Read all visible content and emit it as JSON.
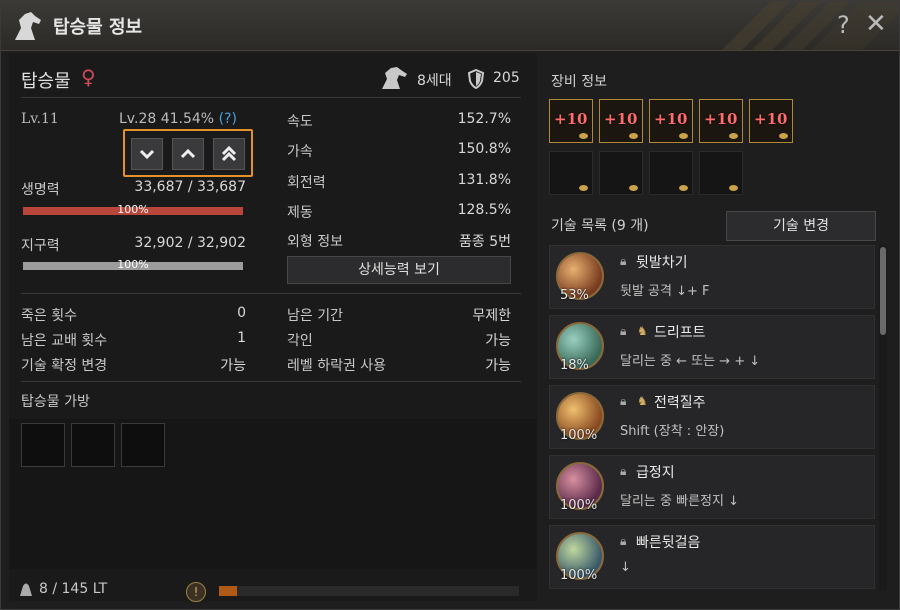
{
  "window": {
    "title": "탑승물 정보",
    "help": "?",
    "close": "✕"
  },
  "mount": {
    "name": "탑승물",
    "gender_icon": "♀",
    "generation": "8세대",
    "armor": "205",
    "level": "Lv.11",
    "exp": "Lv.28 41.54%",
    "exp_help": "(?)"
  },
  "level_buttons": [
    {
      "icon": "chevron-down-icon",
      "glyph": "⌄"
    },
    {
      "icon": "chevron-up-icon",
      "glyph": "⌃"
    },
    {
      "icon": "double-chevron-up-icon",
      "glyph": "⏶"
    }
  ],
  "vitals": {
    "hp_label": "생명력",
    "hp_value": "33,687 / 33,687",
    "hp_pct": "100%",
    "hp_fraction": 1.0,
    "stamina_label": "지구력",
    "stamina_value": "32,902 / 32,902",
    "stamina_pct": "100%",
    "stamina_fraction": 1.0
  },
  "stats": [
    {
      "label": "속도",
      "value": "152.7%"
    },
    {
      "label": "가속",
      "value": "150.8%"
    },
    {
      "label": "회전력",
      "value": "131.8%"
    },
    {
      "label": "제동",
      "value": "128.5%"
    },
    {
      "label": "외형 정보",
      "value": "품종 5번"
    }
  ],
  "detail_button": "상세능력 보기",
  "info_left": [
    {
      "label": "죽은 횟수",
      "value": "0"
    },
    {
      "label": "남은 교배 횟수",
      "value": "1"
    },
    {
      "label": "기술 확정 변경",
      "value": "가능"
    }
  ],
  "info_right": [
    {
      "label": "남은 기간",
      "value": "무제한"
    },
    {
      "label": "각인",
      "value": "가능"
    },
    {
      "label": "레벨 하락권 사용",
      "value": "가능"
    }
  ],
  "bag": {
    "title": "탑승물 가방"
  },
  "footer": {
    "weight": "8 / 145 LT",
    "exp_fraction": 0.06
  },
  "equipment": {
    "title": "장비 정보",
    "enhance": [
      "+10",
      "+10",
      "+10",
      "+10",
      "+10"
    ]
  },
  "skills": {
    "title": "기술 목록 (9 개)",
    "change_button": "기술 변경",
    "items": [
      {
        "name": "뒷발차기",
        "desc": "뒷발 공격 ↓+ F",
        "pct": "53%",
        "horse": false
      },
      {
        "name": "드리프트",
        "desc": "달리는 중 ← 또는 → + ↓",
        "pct": "18%",
        "horse": true
      },
      {
        "name": "전력질주",
        "desc": "Shift (장착 : 안장)",
        "pct": "100%",
        "horse": true
      },
      {
        "name": "급정지",
        "desc": "달리는 중 빠른정지 ↓",
        "pct": "100%",
        "horse": false
      },
      {
        "name": "빠른뒷걸음",
        "desc": "↓",
        "pct": "100%",
        "horse": false
      }
    ]
  },
  "colors": {
    "accent_orange": "#e0932a",
    "hp_bar": "#b8463a",
    "stamina_bar": "#9c9c9c",
    "enhance_text": "#ff6a6a",
    "female": "#d04a5a"
  }
}
